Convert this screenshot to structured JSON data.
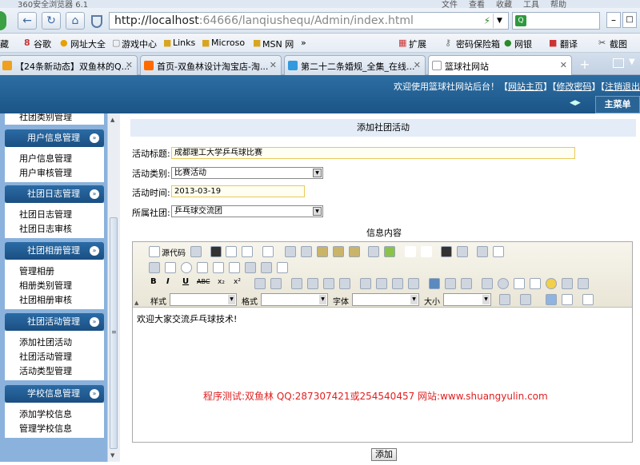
{
  "browser": {
    "app_title": "360安全浏览器 6.1",
    "menus": [
      "文件",
      "查看",
      "收藏",
      "工具",
      "帮助"
    ],
    "url_host": "http://localhost",
    "url_rest": ":64666/lanqiushequ/Admin/index.html",
    "favorites": [
      "藏",
      "谷歌",
      "网址大全",
      "游戏中心",
      "Links",
      "Microso",
      "MSN 网",
      "»",
      "扩展",
      "密码保险箱",
      "网银",
      "翻译",
      "截图"
    ],
    "tabs": [
      {
        "label": "【24条新动态】双鱼林的Q...",
        "color": "#f0a020"
      },
      {
        "label": "首页-双鱼林设计淘宝店-淘...",
        "color": "#ff6a00"
      },
      {
        "label": "第二十二条婚规_全集_在线...",
        "color": "#3399dd"
      },
      {
        "label": "篮球社网站",
        "color": "#ffffff"
      }
    ]
  },
  "header": {
    "welcome": "欢迎使用篮球社网站后台！",
    "link_home": "网站主页",
    "link_pwd": "修改密码",
    "link_logout": "注销退出",
    "main_menu": "主菜单"
  },
  "sidebar": {
    "top_cut": "社团类别管理",
    "groups": [
      {
        "title": "用户信息管理",
        "items": [
          "用户信息管理",
          "用户审核管理"
        ]
      },
      {
        "title": "社团日志管理",
        "items": [
          "社团日志管理",
          "社团日志审核"
        ]
      },
      {
        "title": "社团相册管理",
        "items": [
          "管理相册",
          "相册类别管理",
          "社团相册审核"
        ]
      },
      {
        "title": "社团活动管理",
        "items": [
          "添加社团活动",
          "社团活动管理",
          "活动类型管理"
        ]
      },
      {
        "title": "学校信息管理",
        "items": [
          "添加学校信息",
          "管理学校信息"
        ]
      }
    ]
  },
  "form": {
    "title": "添加社团活动",
    "title_label": "活动标题:",
    "title_value": "成都理工大学乒乓球比赛",
    "type_label": "活动类别:",
    "type_value": "比赛活动",
    "time_label": "活动时间:",
    "time_value": "2013-03-19",
    "club_label": "所属社团:",
    "club_value": "乒乓球交流团",
    "content_label": "信息内容",
    "source_label": "源代码",
    "style_label": "样式",
    "format_label": "格式",
    "font_label": "字体",
    "size_label": "大小",
    "editor_text": "欢迎大家交流乒乓球技术!",
    "watermark": "程序测试:双鱼林 QQ:287307421或254540457 网站:www.shuangyulin.com",
    "submit_label": "添加"
  },
  "colors": {
    "header": "#1c5486",
    "sidebar": "#8ab2dc",
    "watermark": "#e02020"
  }
}
